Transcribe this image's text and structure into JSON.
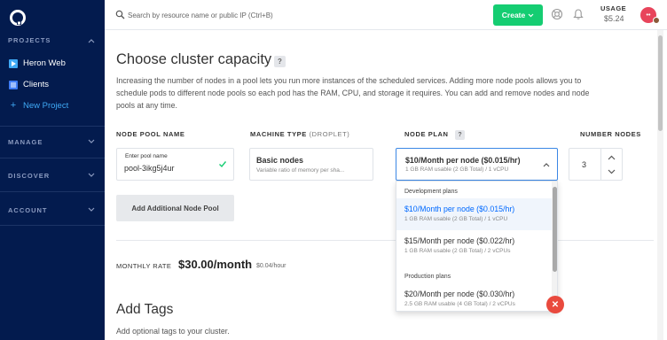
{
  "sidebar": {
    "projects_heading": "PROJECTS",
    "projects": [
      {
        "label": "Heron Web",
        "icon": "play-icon"
      },
      {
        "label": "Clients",
        "icon": "list-icon"
      }
    ],
    "new_project": "New Project",
    "sections": [
      "MANAGE",
      "DISCOVER",
      "ACCOUNT"
    ]
  },
  "topbar": {
    "search_placeholder": "Search by resource name or public IP (Ctrl+B)",
    "create_label": "Create",
    "usage_label": "USAGE",
    "usage_value": "$5.24"
  },
  "main": {
    "title": "Choose cluster capacity",
    "help": "?",
    "description": "Increasing the number of nodes in a pool lets you run more instances of the scheduled services. Adding more node pools allows you to schedule pods to different node pools so each pod has the RAM, CPU, and storage it requires. You can add and remove nodes and node pools at any time.",
    "columns": {
      "node_pool_name": "NODE POOL NAME",
      "machine_type": "MACHINE TYPE",
      "machine_type_sub": "(DROPLET)",
      "node_plan": "NODE PLAN",
      "number_nodes": "NUMBER NODES"
    },
    "pool_name": {
      "small_label": "Enter pool name",
      "value": "pool-3ikg5j4ur"
    },
    "machine": {
      "title": "Basic nodes",
      "desc": "Variable ratio of memory per sha..."
    },
    "plan": {
      "title": "$10/Month per node ($0.015/hr)",
      "desc": "1 GB RAM usable (2 GB Total) / 1 vCPU"
    },
    "number_nodes": "3",
    "add_pool_button": "Add Additional Node Pool",
    "monthly_rate_label": "MONTHLY RATE",
    "monthly_rate_value": "$30.00/month",
    "monthly_rate_hour": "$0.04/hour",
    "tags_title": "Add Tags",
    "tags_desc": "Add optional tags to your cluster."
  },
  "dropdown": {
    "groups": [
      {
        "label": "Development plans",
        "options": [
          {
            "title": "$10/Month per node ($0.015/hr)",
            "sub": "1 GB RAM usable (2 GB Total) / 1 vCPU",
            "selected": true
          },
          {
            "title": "$15/Month per node ($0.022/hr)",
            "sub": "1 GB RAM usable (2 GB Total) / 2 vCPUs",
            "selected": false
          }
        ]
      },
      {
        "label": "Production plans",
        "options": [
          {
            "title": "$20/Month per node ($0.030/hr)",
            "sub": "2.5 GB RAM usable (4 GB Total) / 2 vCPUs",
            "selected": false
          }
        ]
      }
    ]
  },
  "colors": {
    "sidebar_bg": "#031b4e",
    "create_green": "#15cd72",
    "accent_blue": "#0069ff"
  }
}
